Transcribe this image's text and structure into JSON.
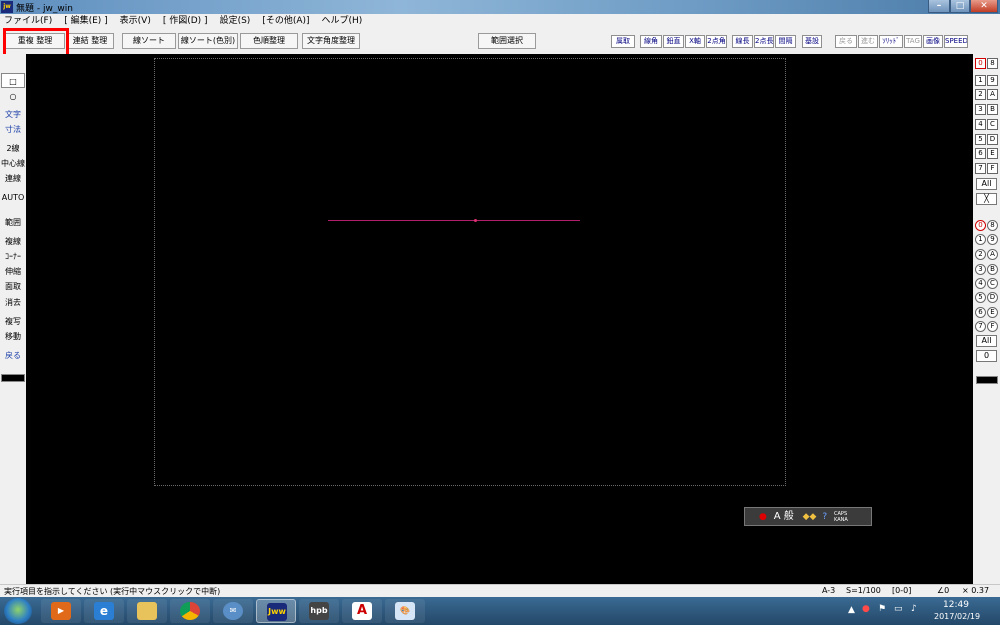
{
  "window": {
    "title": "無題 - jw_win",
    "app_icon_label": "jw"
  },
  "menu": [
    "ファイル(F)",
    "[ 編集(E) ]",
    "表示(V)",
    "[ 作図(D) ]",
    "設定(S)",
    "[その他(A)]",
    "ヘルプ(H)"
  ],
  "toolbar_main": [
    "重複 整理",
    "連結 整理",
    "線ソート",
    "線ソート(色別)",
    "色順整理",
    "文字角度整理",
    "範囲選択"
  ],
  "toolbar_right": [
    "属取",
    "線角",
    "鉛直",
    "X軸",
    "2点角",
    "線長",
    "2点長",
    "間隔",
    "基設"
  ],
  "toolbar_right_gray": [
    "戻る",
    "進む",
    "ｿﾘｯﾄﾞ",
    "TAG",
    "画像",
    "SPEED"
  ],
  "left_tools": [
    "□",
    "○",
    "文字",
    "寸法",
    "2線",
    "中心線",
    "連線",
    "AUTO",
    "範囲",
    "複線",
    "ｺｰﾅｰ",
    "伸縮",
    "面取",
    "消去",
    "複写",
    "移動",
    "戻る"
  ],
  "layer_groups": [
    "0",
    "1",
    "2",
    "3",
    "4",
    "5",
    "6",
    "7",
    "8",
    "9",
    "A",
    "B",
    "C",
    "D",
    "E",
    "F"
  ],
  "layer_all": "All",
  "layers": [
    "0",
    "1",
    "2",
    "3",
    "4",
    "5",
    "6",
    "7",
    "8",
    "9",
    "A",
    "B",
    "C",
    "D",
    "E",
    "F"
  ],
  "layer_zero": "0",
  "ime": {
    "text": "A 般",
    "caps": "CAPS",
    "kana": "KANA"
  },
  "status": {
    "message": "実行項目を指示してください (実行中マウスクリックで中断)",
    "paper": "A-3",
    "scale": "S=1/100",
    "layer": "[0-0]",
    "angle": "∠0",
    "zoom": "× 0.37"
  },
  "taskbar": {
    "apps": [
      "media-player",
      "internet-explorer",
      "file-explorer",
      "chrome",
      "mail",
      "jw-cad",
      "hpb",
      "acrobat",
      "paint"
    ],
    "jw_label": "Jww",
    "hpb_label": "hpb",
    "time": "12:49",
    "date": "2017/02/19"
  },
  "colors": {
    "canvas": "#000000",
    "drawn_line": "#b0206a",
    "highlight": "#ff0000"
  }
}
